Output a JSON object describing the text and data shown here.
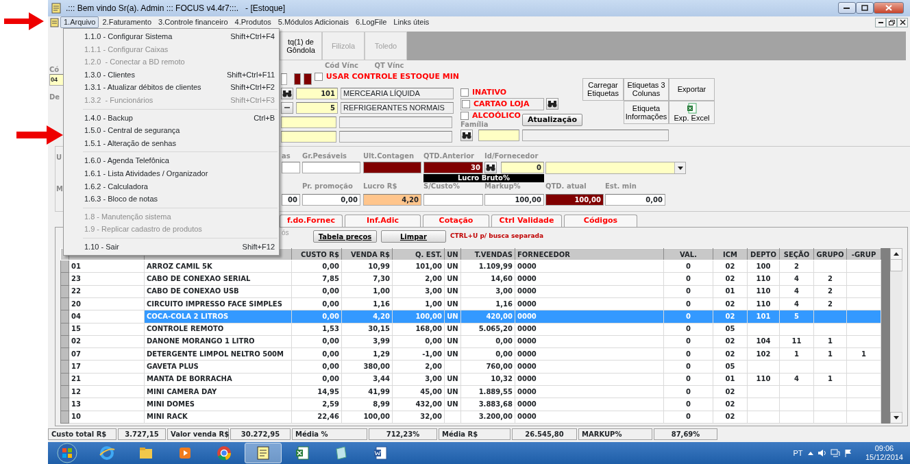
{
  "window": {
    "title": ".::: Bem vindo Sr(a). Admin ::: FOCUS v4.4r7:::.   - [Estoque]"
  },
  "menu_bar": [
    {
      "label": "1.Arquivo",
      "selected": true
    },
    {
      "label": "2.Faturamento",
      "selected": false
    },
    {
      "label": "3.Controle financeiro",
      "selected": false
    },
    {
      "label": "4.Produtos",
      "selected": false
    },
    {
      "label": "5.Módulos Adicionais",
      "selected": false
    },
    {
      "label": "6.LogFile",
      "selected": false
    },
    {
      "label": "Links úteis",
      "selected": false
    }
  ],
  "open_menu": [
    {
      "kind": "item",
      "label": "1.1.0 - Configurar Sistema",
      "shortcut": "Shift+Ctrl+F4",
      "disabled": false
    },
    {
      "kind": "item",
      "label": "1.1.1 - Configurar Caixas",
      "disabled": true
    },
    {
      "kind": "item",
      "label": "1.2.0  - Conectar a BD remoto",
      "disabled": true
    },
    {
      "kind": "item",
      "label": "1.3.0 - Clientes",
      "shortcut": "Shift+Ctrl+F11",
      "disabled": false
    },
    {
      "kind": "item",
      "label": "1.3.1 - Atualizar débitos de clientes",
      "shortcut": "Shift+Ctrl+F2",
      "disabled": false
    },
    {
      "kind": "item",
      "label": "1.3.2  - Funcionários",
      "shortcut": "Shift+Ctrl+F3",
      "disabled": true
    },
    {
      "kind": "separator"
    },
    {
      "kind": "item",
      "label": "1.4.0 - Backup",
      "shortcut": "Ctrl+B",
      "disabled": false
    },
    {
      "kind": "item",
      "label": "1.5.0 - Central de segurança",
      "disabled": false
    },
    {
      "kind": "item",
      "label": "1.5.1 - Alteração de senhas",
      "disabled": false
    },
    {
      "kind": "separator"
    },
    {
      "kind": "item",
      "label": "1.6.0 - Agenda Telefônica",
      "disabled": false
    },
    {
      "kind": "item",
      "label": "1.6.1 - Lista Atividades / Organizador",
      "disabled": false
    },
    {
      "kind": "item",
      "label": "1.6.2 - Calculadora",
      "disabled": false
    },
    {
      "kind": "item",
      "label": "1.6.3 - Bloco de notas",
      "disabled": false
    },
    {
      "kind": "separator"
    },
    {
      "kind": "item",
      "label": "1.8 - Manutenção sistema",
      "disabled": true
    },
    {
      "kind": "item",
      "label": "1.9 - Replicar cadastro de produtos",
      "disabled": true
    },
    {
      "kind": "separator"
    },
    {
      "kind": "item",
      "label": "1.10 - Sair",
      "shortcut": "Shift+F12",
      "disabled": false
    }
  ],
  "toolbar": [
    {
      "lines": [
        "tq(1) de",
        "Gôndola"
      ],
      "disabled": false
    },
    {
      "lines": [
        "Filizola"
      ],
      "disabled": true
    },
    {
      "lines": [
        "Toledo"
      ],
      "disabled": true
    }
  ],
  "form": {
    "left_fragments": {
      "code_label": "Có",
      "code_value": "04",
      "description_label": "De"
    },
    "link_labels": [
      "Cód Vínc",
      "QT Vínc"
    ],
    "min_stock_control": {
      "label": "USAR CONTROLE ESTOQUE MIN",
      "checked": false
    },
    "department": {
      "code": "101",
      "name": "MERCEARIA LÍQUIDA"
    },
    "section": {
      "code": "5",
      "name": "REFRIGERANTES NORMAIS"
    },
    "flags": [
      {
        "label": "INATIVO",
        "checked": false
      },
      {
        "label": "CARTAO LOJA",
        "checked": false
      },
      {
        "label": "ALCOÓLICO",
        "checked": false
      }
    ],
    "update_button": "Atualização",
    "family_label": "Família",
    "action_buttons": [
      {
        "lines": [
          "Carregar",
          "Etiquetas"
        ]
      },
      {
        "lines": [
          "Etiquetas 3",
          "Colunas"
        ]
      },
      {
        "lines": [
          "Exportar"
        ]
      },
      {
        "lines": [
          "Etiqueta",
          "Informações"
        ]
      },
      {
        "lines": [
          "Exp. Excel"
        ]
      }
    ]
  },
  "stock": {
    "left_fragments": [
      "U",
      "M"
    ],
    "row1": [
      {
        "label": "as"
      },
      {
        "label": "Gr.Pesáveis"
      },
      {
        "label": "Ult.Contagen"
      },
      {
        "label": "QTD.Anterior",
        "value": "30"
      },
      {
        "label": "Id/Fornecedor",
        "value": "0"
      }
    ],
    "profit_caption": "Lucro Bruto%",
    "row2": [
      {
        "value": "00"
      },
      {
        "label": "Pr. promoção",
        "value": "0,00"
      },
      {
        "label": "Lucro R$",
        "value": "4,20"
      },
      {
        "label": "S/Custo%"
      },
      {
        "label": "Markup%",
        "value": "100,00"
      },
      {
        "label": "QTD. atual",
        "value": "100,00"
      },
      {
        "label": "Est. min",
        "value": "0,00"
      }
    ]
  },
  "tabs": [
    {
      "label": "f.do.Fornec",
      "selected": false
    },
    {
      "label": "Inf.Adic",
      "selected": false
    },
    {
      "label": "Cotação",
      "selected": false
    },
    {
      "label": "Ctrl Validade",
      "selected": false
    },
    {
      "label": "Códigos",
      "selected": false
    }
  ],
  "grid_toolbar": {
    "fragment": "ós",
    "buttons": [
      "Tabela preços",
      "Limpar"
    ],
    "hint": "CTRL+U p/ busca separada"
  },
  "table": {
    "columns": [
      "",
      "",
      "CUSTO R$",
      "VENDA R$",
      "Q. EST.",
      "UN",
      "T.VENDAS",
      "FORNECEDOR",
      "VAL.",
      "ICM",
      "DEPTO",
      "SEÇÃO",
      "GRUPO",
      "-GRUP"
    ],
    "rows": [
      {
        "selected": false,
        "cells": [
          "01",
          "ARROZ CAMIL 5K",
          "0,00",
          "10,99",
          "101,00",
          "UN",
          "1.109,99",
          "0000",
          "0",
          "02",
          "100",
          "2",
          null,
          null
        ]
      },
      {
        "selected": false,
        "cells": [
          "23",
          "CABO DE CONEXAO SERIAL",
          "7,85",
          "7,30",
          "2,00",
          "UN",
          "14,60",
          "0000",
          "0",
          "02",
          "110",
          "4",
          "2",
          null
        ]
      },
      {
        "selected": false,
        "cells": [
          "22",
          "CABO DE CONEXAO USB",
          "0,00",
          "1,00",
          "3,00",
          "UN",
          "3,00",
          "0000",
          "0",
          "01",
          "110",
          "4",
          "2",
          null
        ]
      },
      {
        "selected": false,
        "cells": [
          "20",
          "CIRCUITO IMPRESSO FACE SIMPLES",
          "0,00",
          "1,16",
          "1,00",
          "UN",
          "1,16",
          "0000",
          "0",
          "02",
          "110",
          "4",
          "2",
          null
        ]
      },
      {
        "selected": true,
        "cells": [
          "04",
          "COCA-COLA 2 LITROS",
          "0,00",
          "4,20",
          "100,00",
          "UN",
          "420,00",
          "0000",
          "0",
          "02",
          "101",
          "5",
          null,
          null
        ]
      },
      {
        "selected": false,
        "cells": [
          "15",
          "CONTROLE REMOTO",
          "1,53",
          "30,15",
          "168,00",
          "UN",
          "5.065,20",
          "0000",
          "0",
          "05",
          null,
          null,
          null,
          null
        ]
      },
      {
        "selected": false,
        "cells": [
          "02",
          "DANONE MORANGO 1 LITRO",
          "0,00",
          "3,99",
          "0,00",
          "UN",
          "0,00",
          "0000",
          "0",
          "02",
          "104",
          "11",
          "1",
          null
        ]
      },
      {
        "selected": false,
        "cells": [
          "07",
          "DETERGENTE LIMPOL NELTRO 500M",
          "0,00",
          "1,29",
          "-1,00",
          "UN",
          "0,00",
          "0000",
          "0",
          "02",
          "102",
          "1",
          "1",
          "1"
        ]
      },
      {
        "selected": false,
        "cells": [
          "17",
          "GAVETA PLUS",
          "0,00",
          "380,00",
          "2,00",
          null,
          "760,00",
          "0000",
          "0",
          "05",
          null,
          null,
          null,
          null
        ]
      },
      {
        "selected": false,
        "cells": [
          "21",
          "MANTA DE BORRACHA",
          "0,00",
          "3,44",
          "3,00",
          "UN",
          "10,32",
          "0000",
          "0",
          "01",
          "110",
          "4",
          "1",
          null
        ]
      },
      {
        "selected": false,
        "cells": [
          "12",
          "MINI CAMERA DAY",
          "14,95",
          "41,99",
          "45,00",
          "UN",
          "1.889,55",
          "0000",
          "0",
          "02",
          null,
          null,
          null,
          null
        ]
      },
      {
        "selected": false,
        "cells": [
          "13",
          "MINI DOMES",
          "2,59",
          "8,99",
          "432,00",
          "UN",
          "3.883,68",
          "0000",
          "0",
          "02",
          null,
          null,
          null,
          null
        ]
      },
      {
        "selected": false,
        "cells": [
          "10",
          "MINI RACK",
          "22,46",
          "100,00",
          "32,00",
          null,
          "3.200,00",
          "0000",
          "0",
          "02",
          null,
          null,
          null,
          null
        ]
      }
    ]
  },
  "status_bar": [
    {
      "label": "Custo total R$",
      "value": "3.727,15"
    },
    {
      "label": "Valor venda R$",
      "value": "30.272,95"
    },
    {
      "label": "Média %",
      "value": "712,23%"
    },
    {
      "label": "Média R$",
      "value": "26.545,80"
    },
    {
      "label": "MARKUP%",
      "value": "87,69%"
    }
  ],
  "taskbar": {
    "apps": [
      {
        "selected": false
      },
      {
        "selected": false
      },
      {
        "selected": false
      },
      {
        "selected": false
      },
      {
        "selected": true
      },
      {
        "selected": false
      },
      {
        "selected": false
      },
      {
        "selected": false
      }
    ],
    "language": "PT",
    "time": "09:06",
    "date": "15/12/2014"
  }
}
